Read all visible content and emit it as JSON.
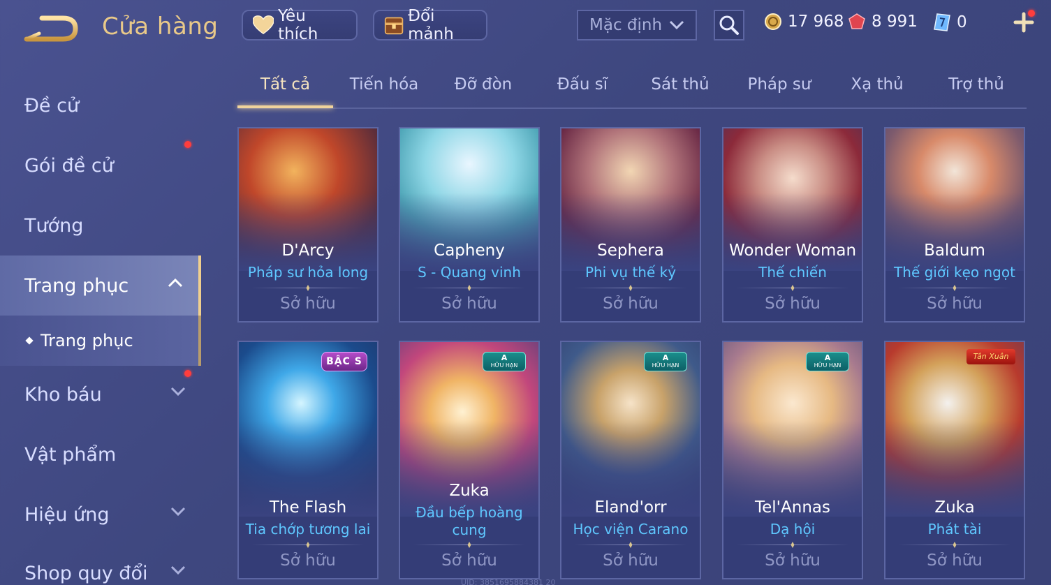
{
  "header": {
    "title": "Cửa hàng",
    "favorite_label": "Yêu thích",
    "fragment_label": "Đổi mảnh",
    "sort_value": "Mặc định",
    "currencies": [
      {
        "name": "gold",
        "value": "17 968"
      },
      {
        "name": "ruby",
        "value": "8 991"
      },
      {
        "name": "voucher",
        "value": "0"
      }
    ]
  },
  "sidebar": {
    "items": [
      {
        "label": "Đề cử"
      },
      {
        "label": "Gói đề cử"
      },
      {
        "label": "Tướng"
      },
      {
        "label": "Trang phục"
      },
      {
        "label": "Kho báu"
      },
      {
        "label": "Vật phẩm"
      },
      {
        "label": "Hiệu ứng"
      },
      {
        "label": "Shop quy đổi"
      }
    ],
    "sub_item": "Trang phục"
  },
  "tabs": [
    "Tất cả",
    "Tiến hóa",
    "Đỡ đòn",
    "Đấu sĩ",
    "Sát thủ",
    "Pháp sư",
    "Xạ thủ",
    "Trợ thủ"
  ],
  "cards": [
    {
      "hero": "D'Arcy",
      "skin": "Pháp sư hỏa long",
      "status": "Sở hữu"
    },
    {
      "hero": "Capheny",
      "skin": "S - Quang vinh",
      "status": "Sở hữu"
    },
    {
      "hero": "Sephera",
      "skin": "Phi vụ thế kỷ",
      "status": "Sở hữu"
    },
    {
      "hero": "Wonder Woman",
      "skin": "Thế chiến",
      "status": "Sở hữu"
    },
    {
      "hero": "Baldum",
      "skin": "Thế giới kẹo ngọt",
      "status": "Sở hữu"
    },
    {
      "hero": "The Flash",
      "skin": "Tia chớp tương lai",
      "status": "Sở hữu",
      "badge": "BẬC S"
    },
    {
      "hero": "Zuka",
      "skin": "Đầu bếp hoàng cung",
      "status": "Sở hữu",
      "badge_title": "A",
      "badge_sub": "HỮU HẠN"
    },
    {
      "hero": "Eland'orr",
      "skin": "Học viện Carano",
      "status": "Sở hữu",
      "badge_title": "A",
      "badge_sub": "HỮU HẠN"
    },
    {
      "hero": "Tel'Annas",
      "skin": "Dạ hội",
      "status": "Sở hữu",
      "badge_title": "A",
      "badge_sub": "HỮU HẠN"
    },
    {
      "hero": "Zuka",
      "skin": "Phát tài",
      "status": "Sở hữu",
      "badge": "Tân Xuân"
    }
  ],
  "colors": {
    "background": "#414a86",
    "accent_gold": "#e9c989",
    "skin_name": "#5fc8ff",
    "owned_text": "#8f96c4"
  },
  "footer": {
    "uid": "UID: 3851695884381 20"
  }
}
